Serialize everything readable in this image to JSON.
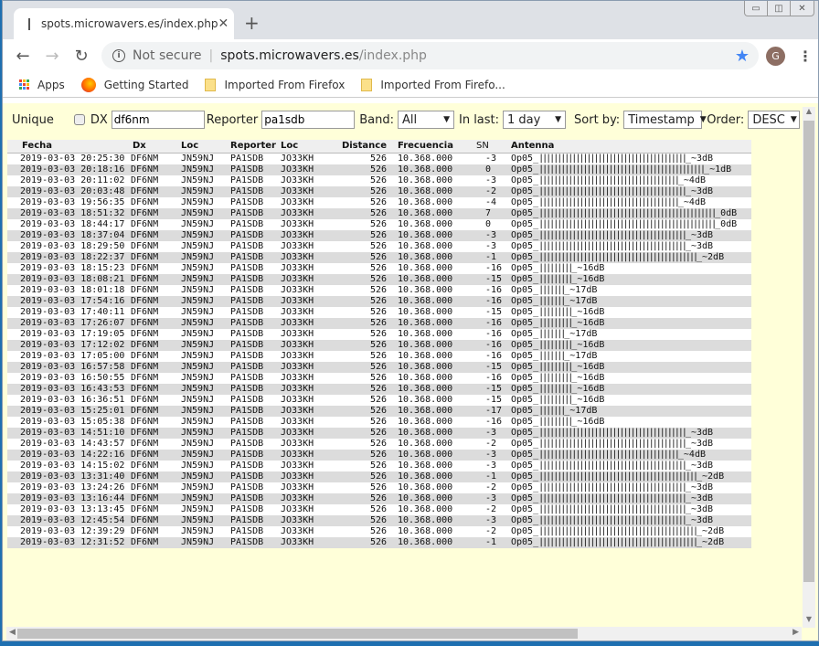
{
  "browser": {
    "tab_title": "spots.microwavers.es/index.php",
    "not_secure": "Not secure",
    "url_host": "spots.microwavers.es",
    "url_path": "/index.php",
    "profile_initial": "G",
    "bookmarks": [
      {
        "label": "Apps",
        "icon": "apps-icon"
      },
      {
        "label": "Getting Started",
        "icon": "firefox-icon"
      },
      {
        "label": "Imported From Firefox",
        "icon": "folder-icon"
      },
      {
        "label": "Imported From Firefo...",
        "icon": "folder-icon"
      }
    ]
  },
  "filters": {
    "unique_label": "Unique",
    "unique_checked": false,
    "dx_label": "DX",
    "dx_value": "df6nm",
    "reporter_label": "Reporter",
    "reporter_value": "pa1sdb",
    "band_label": "Band:",
    "band_value": "All",
    "inlast_label": "In last:",
    "inlast_value": "1 day",
    "sortby_label": "Sort by:",
    "sortby_value": "Timestamp",
    "order_label": "Order:",
    "order_value": "DESC"
  },
  "table": {
    "headers": [
      "Fecha",
      "Dx",
      "Loc",
      "Reporter",
      "Loc",
      "Distance",
      "Frecuencia",
      "SN",
      "Antenna"
    ],
    "rows": [
      {
        "fecha": "2019-03-03 20:25:30",
        "dx": "DF6NM",
        "loc": "JN59NJ",
        "reporter": "PA1SDB",
        "rloc": "JO33KH",
        "distance": "526",
        "freq": "10.368.000",
        "sn": "-3",
        "ant_prefix": "Op05_",
        "ant_bars": 40,
        "ant_suffix": "_~3dB"
      },
      {
        "fecha": "2019-03-03 20:18:16",
        "dx": "DF6NM",
        "loc": "JN59NJ",
        "reporter": "PA1SDB",
        "rloc": "JO33KH",
        "distance": "526",
        "freq": "10.368.000",
        "sn": "0",
        "ant_prefix": "Op05_",
        "ant_bars": 45,
        "ant_suffix": "_~1dB"
      },
      {
        "fecha": "2019-03-03 20:11:02",
        "dx": "DF6NM",
        "loc": "JN59NJ",
        "reporter": "PA1SDB",
        "rloc": "JO33KH",
        "distance": "526",
        "freq": "10.368.000",
        "sn": "-3",
        "ant_prefix": "Op05_",
        "ant_bars": 38,
        "ant_suffix": "_~4dB"
      },
      {
        "fecha": "2019-03-03 20:03:48",
        "dx": "DF6NM",
        "loc": "JN59NJ",
        "reporter": "PA1SDB",
        "rloc": "JO33KH",
        "distance": "526",
        "freq": "10.368.000",
        "sn": "-2",
        "ant_prefix": "Op05_",
        "ant_bars": 40,
        "ant_suffix": "_~3dB"
      },
      {
        "fecha": "2019-03-03 19:56:35",
        "dx": "DF6NM",
        "loc": "JN59NJ",
        "reporter": "PA1SDB",
        "rloc": "JO33KH",
        "distance": "526",
        "freq": "10.368.000",
        "sn": "-4",
        "ant_prefix": "Op05_",
        "ant_bars": 38,
        "ant_suffix": "_~4dB"
      },
      {
        "fecha": "2019-03-03 18:51:32",
        "dx": "DF6NM",
        "loc": "JN59NJ",
        "reporter": "PA1SDB",
        "rloc": "JO33KH",
        "distance": "526",
        "freq": "10.368.000",
        "sn": "7",
        "ant_prefix": "Op05_",
        "ant_bars": 48,
        "ant_suffix": "_0dB"
      },
      {
        "fecha": "2019-03-03 18:44:17",
        "dx": "DF6NM",
        "loc": "JN59NJ",
        "reporter": "PA1SDB",
        "rloc": "JO33KH",
        "distance": "526",
        "freq": "10.368.000",
        "sn": "0",
        "ant_prefix": "Op05_",
        "ant_bars": 48,
        "ant_suffix": "_0dB"
      },
      {
        "fecha": "2019-03-03 18:37:04",
        "dx": "DF6NM",
        "loc": "JN59NJ",
        "reporter": "PA1SDB",
        "rloc": "JO33KH",
        "distance": "526",
        "freq": "10.368.000",
        "sn": "-3",
        "ant_prefix": "Op05_",
        "ant_bars": 40,
        "ant_suffix": "_~3dB"
      },
      {
        "fecha": "2019-03-03 18:29:50",
        "dx": "DF6NM",
        "loc": "JN59NJ",
        "reporter": "PA1SDB",
        "rloc": "JO33KH",
        "distance": "526",
        "freq": "10.368.000",
        "sn": "-3",
        "ant_prefix": "Op05_",
        "ant_bars": 40,
        "ant_suffix": "_~3dB"
      },
      {
        "fecha": "2019-03-03 18:22:37",
        "dx": "DF6NM",
        "loc": "JN59NJ",
        "reporter": "PA1SDB",
        "rloc": "JO33KH",
        "distance": "526",
        "freq": "10.368.000",
        "sn": "-1",
        "ant_prefix": "Op05_",
        "ant_bars": 43,
        "ant_suffix": "_~2dB"
      },
      {
        "fecha": "2019-03-03 18:15:23",
        "dx": "DF6NM",
        "loc": "JN59NJ",
        "reporter": "PA1SDB",
        "rloc": "JO33KH",
        "distance": "526",
        "freq": "10.368.000",
        "sn": "-16",
        "ant_prefix": "Op05_",
        "ant_bars": 9,
        "ant_suffix": "_~16dB"
      },
      {
        "fecha": "2019-03-03 18:08:21",
        "dx": "DF6NM",
        "loc": "JN59NJ",
        "reporter": "PA1SDB",
        "rloc": "JO33KH",
        "distance": "526",
        "freq": "10.368.000",
        "sn": "-15",
        "ant_prefix": "Op05_",
        "ant_bars": 9,
        "ant_suffix": "_~16dB"
      },
      {
        "fecha": "2019-03-03 18:01:18",
        "dx": "DF6NM",
        "loc": "JN59NJ",
        "reporter": "PA1SDB",
        "rloc": "JO33KH",
        "distance": "526",
        "freq": "10.368.000",
        "sn": "-16",
        "ant_prefix": "Op05_",
        "ant_bars": 7,
        "ant_suffix": "_~17dB"
      },
      {
        "fecha": "2019-03-03 17:54:16",
        "dx": "DF6NM",
        "loc": "JN59NJ",
        "reporter": "PA1SDB",
        "rloc": "JO33KH",
        "distance": "526",
        "freq": "10.368.000",
        "sn": "-16",
        "ant_prefix": "Op05_",
        "ant_bars": 7,
        "ant_suffix": "_~17dB"
      },
      {
        "fecha": "2019-03-03 17:40:11",
        "dx": "DF6NM",
        "loc": "JN59NJ",
        "reporter": "PA1SDB",
        "rloc": "JO33KH",
        "distance": "526",
        "freq": "10.368.000",
        "sn": "-15",
        "ant_prefix": "Op05_",
        "ant_bars": 9,
        "ant_suffix": "_~16dB"
      },
      {
        "fecha": "2019-03-03 17:26:07",
        "dx": "DF6NM",
        "loc": "JN59NJ",
        "reporter": "PA1SDB",
        "rloc": "JO33KH",
        "distance": "526",
        "freq": "10.368.000",
        "sn": "-16",
        "ant_prefix": "Op05_",
        "ant_bars": 9,
        "ant_suffix": "_~16dB"
      },
      {
        "fecha": "2019-03-03 17:19:05",
        "dx": "DF6NM",
        "loc": "JN59NJ",
        "reporter": "PA1SDB",
        "rloc": "JO33KH",
        "distance": "526",
        "freq": "10.368.000",
        "sn": "-16",
        "ant_prefix": "Op05_",
        "ant_bars": 7,
        "ant_suffix": "_~17dB"
      },
      {
        "fecha": "2019-03-03 17:12:02",
        "dx": "DF6NM",
        "loc": "JN59NJ",
        "reporter": "PA1SDB",
        "rloc": "JO33KH",
        "distance": "526",
        "freq": "10.368.000",
        "sn": "-16",
        "ant_prefix": "Op05_",
        "ant_bars": 9,
        "ant_suffix": "_~16dB"
      },
      {
        "fecha": "2019-03-03 17:05:00",
        "dx": "DF6NM",
        "loc": "JN59NJ",
        "reporter": "PA1SDB",
        "rloc": "JO33KH",
        "distance": "526",
        "freq": "10.368.000",
        "sn": "-16",
        "ant_prefix": "Op05_",
        "ant_bars": 7,
        "ant_suffix": "_~17dB"
      },
      {
        "fecha": "2019-03-03 16:57:58",
        "dx": "DF6NM",
        "loc": "JN59NJ",
        "reporter": "PA1SDB",
        "rloc": "JO33KH",
        "distance": "526",
        "freq": "10.368.000",
        "sn": "-15",
        "ant_prefix": "Op05_",
        "ant_bars": 9,
        "ant_suffix": "_~16dB"
      },
      {
        "fecha": "2019-03-03 16:50:55",
        "dx": "DF6NM",
        "loc": "JN59NJ",
        "reporter": "PA1SDB",
        "rloc": "JO33KH",
        "distance": "526",
        "freq": "10.368.000",
        "sn": "-16",
        "ant_prefix": "Op05_",
        "ant_bars": 9,
        "ant_suffix": "_~16dB"
      },
      {
        "fecha": "2019-03-03 16:43:53",
        "dx": "DF6NM",
        "loc": "JN59NJ",
        "reporter": "PA1SDB",
        "rloc": "JO33KH",
        "distance": "526",
        "freq": "10.368.000",
        "sn": "-15",
        "ant_prefix": "Op05_",
        "ant_bars": 9,
        "ant_suffix": "_~16dB"
      },
      {
        "fecha": "2019-03-03 16:36:51",
        "dx": "DF6NM",
        "loc": "JN59NJ",
        "reporter": "PA1SDB",
        "rloc": "JO33KH",
        "distance": "526",
        "freq": "10.368.000",
        "sn": "-15",
        "ant_prefix": "Op05_",
        "ant_bars": 9,
        "ant_suffix": "_~16dB"
      },
      {
        "fecha": "2019-03-03 15:25:01",
        "dx": "DF6NM",
        "loc": "JN59NJ",
        "reporter": "PA1SDB",
        "rloc": "JO33KH",
        "distance": "526",
        "freq": "10.368.000",
        "sn": "-17",
        "ant_prefix": "Op05_",
        "ant_bars": 7,
        "ant_suffix": "_~17dB"
      },
      {
        "fecha": "2019-03-03 15:05:38",
        "dx": "DF6NM",
        "loc": "JN59NJ",
        "reporter": "PA1SDB",
        "rloc": "JO33KH",
        "distance": "526",
        "freq": "10.368.000",
        "sn": "-16",
        "ant_prefix": "Op05_",
        "ant_bars": 9,
        "ant_suffix": "_~16dB"
      },
      {
        "fecha": "2019-03-03 14:51:10",
        "dx": "DF6NM",
        "loc": "JN59NJ",
        "reporter": "PA1SDB",
        "rloc": "JO33KH",
        "distance": "526",
        "freq": "10.368.000",
        "sn": "-3",
        "ant_prefix": "Op05_",
        "ant_bars": 40,
        "ant_suffix": "_~3dB"
      },
      {
        "fecha": "2019-03-03 14:43:57",
        "dx": "DF6NM",
        "loc": "JN59NJ",
        "reporter": "PA1SDB",
        "rloc": "JO33KH",
        "distance": "526",
        "freq": "10.368.000",
        "sn": "-2",
        "ant_prefix": "Op05_",
        "ant_bars": 40,
        "ant_suffix": "_~3dB"
      },
      {
        "fecha": "2019-03-03 14:22:16",
        "dx": "DF6NM",
        "loc": "JN59NJ",
        "reporter": "PA1SDB",
        "rloc": "JO33KH",
        "distance": "526",
        "freq": "10.368.000",
        "sn": "-3",
        "ant_prefix": "Op05_",
        "ant_bars": 38,
        "ant_suffix": "_~4dB"
      },
      {
        "fecha": "2019-03-03 14:15:02",
        "dx": "DF6NM",
        "loc": "JN59NJ",
        "reporter": "PA1SDB",
        "rloc": "JO33KH",
        "distance": "526",
        "freq": "10.368.000",
        "sn": "-3",
        "ant_prefix": "Op05_",
        "ant_bars": 40,
        "ant_suffix": "_~3dB"
      },
      {
        "fecha": "2019-03-03 13:31:40",
        "dx": "DF6NM",
        "loc": "JN59NJ",
        "reporter": "PA1SDB",
        "rloc": "JO33KH",
        "distance": "526",
        "freq": "10.368.000",
        "sn": "-1",
        "ant_prefix": "Op05_",
        "ant_bars": 43,
        "ant_suffix": "_~2dB"
      },
      {
        "fecha": "2019-03-03 13:24:26",
        "dx": "DF6NM",
        "loc": "JN59NJ",
        "reporter": "PA1SDB",
        "rloc": "JO33KH",
        "distance": "526",
        "freq": "10.368.000",
        "sn": "-2",
        "ant_prefix": "Op05_",
        "ant_bars": 40,
        "ant_suffix": "_~3dB"
      },
      {
        "fecha": "2019-03-03 13:16:44",
        "dx": "DF6NM",
        "loc": "JN59NJ",
        "reporter": "PA1SDB",
        "rloc": "JO33KH",
        "distance": "526",
        "freq": "10.368.000",
        "sn": "-3",
        "ant_prefix": "Op05_",
        "ant_bars": 40,
        "ant_suffix": "_~3dB"
      },
      {
        "fecha": "2019-03-03 13:13:45",
        "dx": "DF6NM",
        "loc": "JN59NJ",
        "reporter": "PA1SDB",
        "rloc": "JO33KH",
        "distance": "526",
        "freq": "10.368.000",
        "sn": "-2",
        "ant_prefix": "Op05_",
        "ant_bars": 40,
        "ant_suffix": "_~3dB"
      },
      {
        "fecha": "2019-03-03 12:45:54",
        "dx": "DF6NM",
        "loc": "JN59NJ",
        "reporter": "PA1SDB",
        "rloc": "JO33KH",
        "distance": "526",
        "freq": "10.368.000",
        "sn": "-3",
        "ant_prefix": "Op05_",
        "ant_bars": 40,
        "ant_suffix": "_~3dB"
      },
      {
        "fecha": "2019-03-03 12:39:29",
        "dx": "DF6NM",
        "loc": "JN59NJ",
        "reporter": "PA1SDB",
        "rloc": "JO33KH",
        "distance": "526",
        "freq": "10.368.000",
        "sn": "-2",
        "ant_prefix": "Op05_",
        "ant_bars": 43,
        "ant_suffix": "_~2dB"
      },
      {
        "fecha": "2019-03-03 12:31:52",
        "dx": "DF6NM",
        "loc": "JN59NJ",
        "reporter": "PA1SDB",
        "rloc": "JO33KH",
        "distance": "526",
        "freq": "10.368.000",
        "sn": "-1",
        "ant_prefix": "Op05_",
        "ant_bars": 43,
        "ant_suffix": "_~2dB"
      }
    ]
  }
}
